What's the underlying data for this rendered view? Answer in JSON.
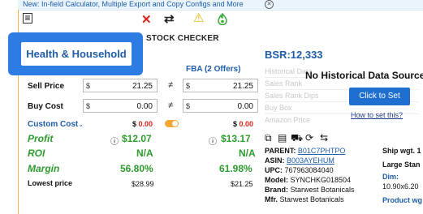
{
  "banner": {
    "text": "New: In-field Calculator, Multiple Export and Copy Configs and More"
  },
  "toolbar": {
    "close": "✕",
    "swap": "⇄",
    "warning": "⚠",
    "flame": "🔥"
  },
  "header": {
    "title": "STOCK CHECKER"
  },
  "badge": {
    "category": "Health & Household"
  },
  "columns": {
    "fba": "FBA (2 Offers)"
  },
  "bsr": {
    "label": "BSR:12,333"
  },
  "sell": {
    "label": "Sell Price",
    "cur": "$",
    "value_left": "21.25",
    "value_right": "21.25"
  },
  "buy": {
    "label": "Buy Cost",
    "cur": "$",
    "value_left": "0.00",
    "value_right": "0.00"
  },
  "custom": {
    "label": "Custom Cost",
    "value_left": "$ 0.00",
    "value_right": "$ 0.00"
  },
  "profit": {
    "label": "Profit",
    "left": "$12.07",
    "right": "$13.17"
  },
  "roi": {
    "label": "ROI",
    "left": "N/A",
    "right": "N/A"
  },
  "margin": {
    "label": "Margin",
    "left": "56.80%",
    "right": "61.98%"
  },
  "lowest": {
    "label": "Lowest price",
    "left": "$28.99",
    "right": "$21.25"
  },
  "history": {
    "ghost_rows": [
      "Historical Data",
      "Sales Rank",
      "Sales Rank Dips",
      "Buy Box",
      "Amazon Price"
    ],
    "message": "No Historical Data Source",
    "button": "Click to Set",
    "link": "How to set this?"
  },
  "product": {
    "parent_label": "PARENT:",
    "parent": "B01C7PHTPO",
    "asin_label": "ASIN:",
    "asin": "B003AYEHUM",
    "upc_label": "UPC:",
    "upc": "767963084040",
    "model_label": "Model:",
    "model": "SYNCHKG018504",
    "brand_label": "Brand:",
    "brand": "Starwest Botanicals",
    "mfr_label": "Mfr.",
    "mfr": "Starwest Botanicals"
  },
  "side": {
    "ship": "Ship wgt. 1",
    "large": "Large Stan",
    "dim_label": "Dim:",
    "dim": "10.90x6.20",
    "product_wgt": "Product wg"
  },
  "colors": {
    "accent": "#2d7ce3",
    "green": "#2e9b2e",
    "red": "#d9261c"
  }
}
